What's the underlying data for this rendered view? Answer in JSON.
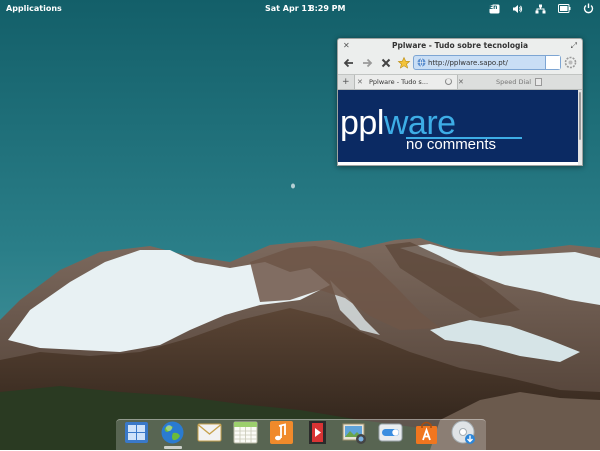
{
  "panel": {
    "applications_label": "Applications",
    "date": "Sat Apr 11",
    "time": "8:29 PM",
    "indicators": [
      "keyboard-layout-icon",
      "volume-icon",
      "network-icon",
      "battery-icon",
      "power-icon"
    ],
    "keyboard_label": "En"
  },
  "browser": {
    "title": "Pplware - Tudo sobre tecnologia",
    "url": "http://pplware.sapo.pt/",
    "tabs": [
      {
        "label": "Pplware - Tudo s...",
        "active": true
      },
      {
        "label": "Speed Dial",
        "active": false
      }
    ],
    "banner": {
      "logo_part1": "ppl",
      "logo_part2": "ware",
      "tagline": "no comments"
    }
  },
  "dock": {
    "items": [
      {
        "name": "multitasking-view",
        "icon": "multitasking-icon",
        "running": false
      },
      {
        "name": "midori-browser",
        "icon": "globe-browser-icon",
        "running": true
      },
      {
        "name": "mail",
        "icon": "envelope-icon",
        "running": false
      },
      {
        "name": "calendar",
        "icon": "calendar-icon",
        "running": false
      },
      {
        "name": "music",
        "icon": "music-note-icon",
        "running": false
      },
      {
        "name": "videos",
        "icon": "film-icon",
        "running": false
      },
      {
        "name": "photos",
        "icon": "camera-photos-icon",
        "running": false
      },
      {
        "name": "system-settings",
        "icon": "toggle-settings-icon",
        "running": false
      },
      {
        "name": "app-center",
        "icon": "app-center-bag-icon",
        "running": false
      },
      {
        "name": "disk-installer",
        "icon": "disc-install-icon",
        "running": false
      }
    ]
  },
  "colors": {
    "sky_top": "#13646f",
    "sky_bottom": "#3a8e98",
    "logo_blue": "#3dade6",
    "banner_bg": "#0b2a63"
  }
}
